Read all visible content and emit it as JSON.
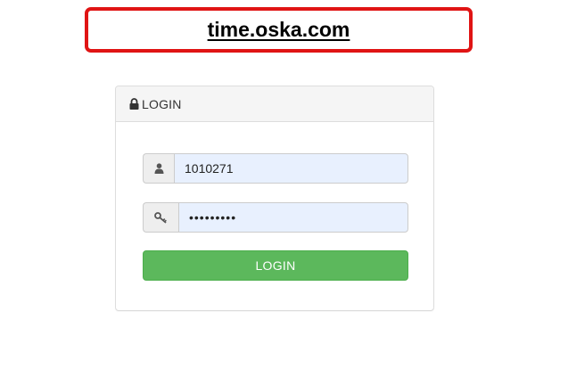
{
  "banner": {
    "site": "time.oska.com"
  },
  "panel": {
    "title": "LOGIN",
    "title_icon": "lock-icon"
  },
  "form": {
    "username": {
      "icon": "user-icon",
      "value": "1010271"
    },
    "password": {
      "icon": "key-icon",
      "value": "•••••••••"
    },
    "submit_label": "LOGIN"
  },
  "colors": {
    "banner_border": "#e01414",
    "button": "#5cb85c",
    "field_autofill": "#e8f0fe"
  }
}
